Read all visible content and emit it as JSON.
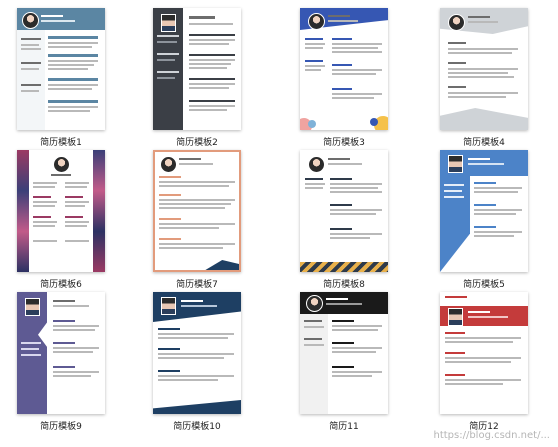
{
  "templates": [
    {
      "label": "简历模板1"
    },
    {
      "label": "简历模板2"
    },
    {
      "label": "简历模板3"
    },
    {
      "label": "简历模板4"
    },
    {
      "label": "简历模板6"
    },
    {
      "label": "简历模板7"
    },
    {
      "label": "简历模板8"
    },
    {
      "label": "简历模板5"
    },
    {
      "label": "简历模板9"
    },
    {
      "label": "简历模板10"
    },
    {
      "label": "简历11"
    },
    {
      "label": "简历12"
    }
  ],
  "watermark": "https://blog.csdn.net/...",
  "colors": {
    "t1": "#5b86a3",
    "t2": "#3b3f46",
    "t3": "#3657b3",
    "t4": "#cfd3d7",
    "t6": "#9b3a63",
    "t7": "#e29b7c",
    "t8": "#2e3a4a",
    "t5": "#4c83c8",
    "t9": "#5e5a93",
    "t10": "#1e3f63",
    "t11": "#1a1a1a",
    "t12": "#c43b3b"
  }
}
